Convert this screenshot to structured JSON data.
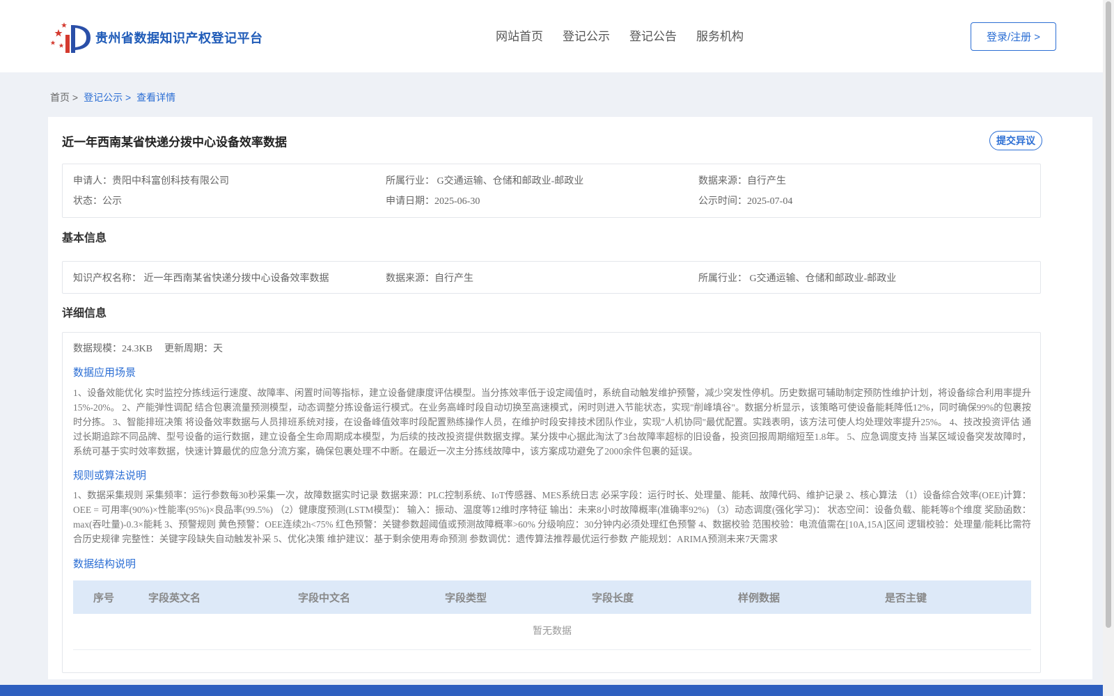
{
  "header": {
    "site_title": "贵州省数据知识产权登记平台",
    "nav": [
      "网站首页",
      "登记公示",
      "登记公告",
      "服务机构"
    ],
    "login_label": "登录/注册 >"
  },
  "breadcrumb": {
    "home": "首页 >",
    "publicity": "登记公示 >",
    "current": "查看详情"
  },
  "detail": {
    "title": "近一年西南某省快递分拨中心设备效率数据",
    "objection_label": "提交异议",
    "meta": {
      "applicant": "申请人：贵阳中科富创科技有限公司",
      "industry": "所属行业：  G交通运输、仓储和邮政业-邮政业",
      "source": "数据来源：自行产生",
      "status": "状态：公示",
      "apply_date": "申请日期：2025-06-30",
      "publish_date": "公示时间：2025-07-04"
    },
    "basic": {
      "section_title": "基本信息",
      "ip_name": "知识产权名称：  近一年西南某省快递分拨中心设备效率数据",
      "source": "数据来源：自行产生",
      "industry": "所属行业：  G交通运输、仓储和邮政业-邮政业"
    },
    "details": {
      "section_title": "详细信息",
      "scale": "数据规模：24.3KB",
      "update_cycle": "更新周期：天",
      "scenario_title": "数据应用场景",
      "scenario_text": "1、设备效能优化 实时监控分拣线运行速度、故障率、闲置时间等指标，建立设备健康度评估模型。当分拣效率低于设定阈值时，系统自动触发维护预警，减少突发性停机。历史数据可辅助制定预防性维护计划，将设备综合利用率提升15%-20%。 2、产能弹性调配 结合包裹流量预测模型，动态调整分拣设备运行模式。在业务高峰时段自动切换至高速模式，闲时则进入节能状态，实现\"削峰填谷\"。数据分析显示，该策略可使设备能耗降低12%，同时确保99%的包裹按时分拣。 3、智能排班决策 将设备效率数据与人员排班系统对接，在设备峰值效率时段配置熟练操作人员，在维护时段安排技术团队作业，实现\"人机协同\"最优配置。实践表明，该方法可使人均处理效率提升25%。 4、技改投资评估 通过长期追踪不同品牌、型号设备的运行数据，建立设备全生命周期成本模型，为后续的技改投资提供数据支撑。某分拨中心据此淘汰了3台故障率超标的旧设备，投资回报周期缩短至1.8年。 5、应急调度支持 当某区域设备突发故障时，系统可基于实时效率数据，快速计算最优的应急分流方案，确保包裹处理不中断。在最近一次主分拣线故障中，该方案成功避免了2000余件包裹的延误。",
      "rules_title": "规则或算法说明",
      "rules_text": "1、数据采集规则 采集频率：运行参数每30秒采集一次，故障数据实时记录 数据来源：PLC控制系统、IoT传感器、MES系统日志 必采字段：运行时长、处理量、能耗、故障代码、维护记录 2、核心算法 （1）设备综合效率(OEE)计算： OEE = 可用率(90%)×性能率(95%)×良品率(99.5%) （2）健康度预测(LSTM模型)： 输入：振动、温度等12维时序特征 输出：未来8小时故障概率(准确率92%) （3）动态调度(强化学习)： 状态空间：设备负载、能耗等8个维度 奖励函数：max(吞吐量)-0.3×能耗 3、预警规则 黄色预警：OEE连续2h<75% 红色预警：关键参数超阈值或预测故障概率>60% 分级响应：30分钟内必须处理红色预警 4、数据校验 范围校验：电流值需在[10A,15A]区间 逻辑校验：处理量/能耗比需符合历史规律 完整性：关键字段缺失自动触发补采 5、优化决策 维护建议：基于剩余使用寿命预测 参数调优：遗传算法推荐最优运行参数 产能规划：ARIMA预测未来7天需求",
      "structure_title": "数据结构说明",
      "table_headers": [
        "序号",
        "字段英文名",
        "字段中文名",
        "字段类型",
        "字段长度",
        "样例数据",
        "是否主键"
      ],
      "empty_text": "暂无数据"
    }
  },
  "colors": {
    "accent": "#2b6ed4",
    "page_bg": "#eef1f6",
    "table_head_bg": "#dde9f8",
    "footer_bg": "#2e5fbf"
  }
}
